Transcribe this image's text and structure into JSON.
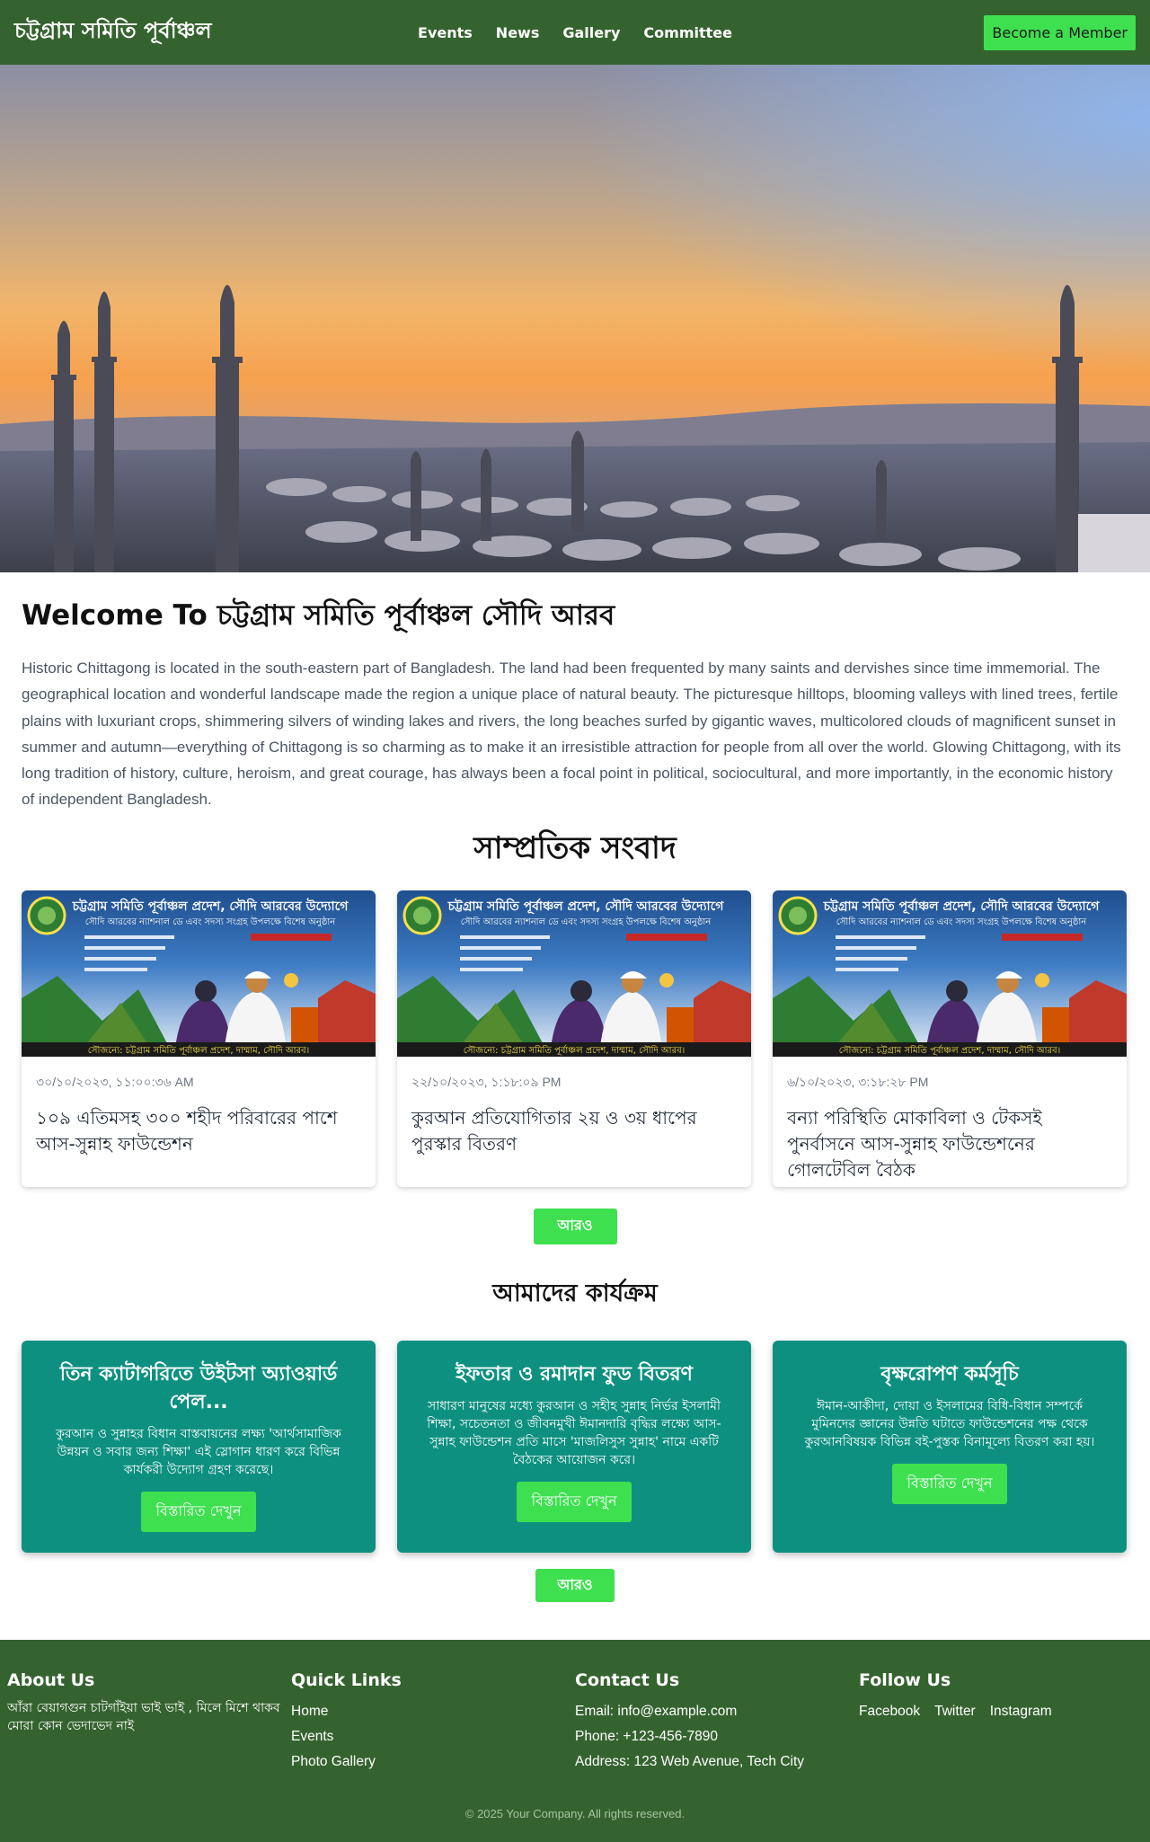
{
  "nav": {
    "brand": "চট্টগ্রাম সমিতি পূর্বাঞ্চল",
    "links": [
      "Events",
      "News",
      "Gallery",
      "Committee"
    ],
    "cta": "Become a Member"
  },
  "welcome": {
    "title": "Welcome To চট্টগ্রাম সমিতি পূর্বাঞ্চল সৌদি আরব",
    "body": "Historic Chittagong is located in the south-eastern part of Bangladesh. The land had been frequented by many saints and dervishes since time immemorial. The geographical location and wonderful landscape made the region a unique place of natural beauty. The picturesque hilltops, blooming valleys with lined trees, fertile plains with luxuriant crops, shimmering silvers of winding lakes and rivers, the long beaches surfed by gigantic waves, multicolored clouds of magnificent sunset in summer and autumn—everything of Chittagong is so charming as to make it an irresistible attraction for people from all over the world. Glowing Chittagong, with its long tradition of history, culture, heroism, and great courage, has always been a focal point in political, sociocultural, and more importantly, in the economic history of independent Bangladesh."
  },
  "news": {
    "title": "সাম্প্রতিক সংবাদ",
    "banner_title": "চট্টগ্রাম সমিতি পূর্বাঞ্চল প্রদেশ, সৌদি আরবের উদ্যোগে",
    "banner_sub": "সৌদি আরবের ন্যাশনাল ডে এবং সদস্য সংগ্রহ উপলক্ষে বিশেষ অনুষ্ঠান",
    "banner_footer": "সৌজন্যে: চট্টগ্রাম সমিতি পূর্বাঞ্চল প্রদেশ, দাম্মাম, সৌদি আরব।",
    "items": [
      {
        "date": "৩০/১০/২০২৩, ১১:০০:৩৬ AM",
        "headline": "১০৯ এতিমসহ ৩০০ শহীদ পরিবারের পাশে আস-সুন্নাহ ফাউন্ডেশন"
      },
      {
        "date": "২২/১০/২০২৩, ১:১৮:০৯ PM",
        "headline": "কুরআন প্রতিযোগিতার ২য় ও ৩য় ধাপের পুরস্কার বিতরণ"
      },
      {
        "date": "৬/১০/২০২৩, ৩:১৮:২৮ PM",
        "headline": "বন্যা পরিস্থিতি মোকাবিলা ও টেকসই পুনর্বাসনে আস-সুন্নাহ ফাউন্ডেশনের গোলটেবিল বৈঠক"
      }
    ],
    "more": "আরও"
  },
  "programs": {
    "title": "আমাদের কার্যক্রম",
    "items": [
      {
        "title": "তিন ক্যাটাগরিতে উইটসা অ্যাওয়ার্ড পেল...",
        "desc": "কুরআন ও সুন্নাহর বিধান বাস্তবায়নের লক্ষ্য 'আর্থসামাজিক উন্নয়ন ও সবার জন্য শিক্ষা' এই স্লোগান ধারণ করে বিভিন্ন কার্যকরী উদ্যোগ গ্রহণ করেছে।",
        "button": "বিস্তারিত দেখুন"
      },
      {
        "title": "ইফতার ও রমাদান ফুড বিতরণ",
        "desc": "সাধারণ মানুষের মধ্যে কুরআন ও সহীহ সুন্নাহ নির্ভর ইসলামী শিক্ষা, সচেতনতা ও জীবনমুখী ঈমানদারি বৃদ্ধির লক্ষ্যে আস-সুন্নাহ ফাউন্ডেশন প্রতি মাসে 'মাজলিসুস সুন্নাহ' নামে একটি বৈঠকের আয়োজন করে।",
        "button": "বিস্তারিত দেখুন"
      },
      {
        "title": "বৃক্ষরোপণ কর্মসূচি",
        "desc": "ঈমান-আকীদা, দোয়া ও ইসলামের বিধি-বিধান সম্পর্কে মুমিনদের জ্ঞানের উন্নতি ঘটাতে ফাউন্ডেশনের পক্ষ থেকে কুরআনবিষয়ক বিভিন্ন বই-পুস্তক বিনামূল্যে বিতরণ করা হয়।",
        "button": "বিস্তারিত দেখুন"
      }
    ],
    "more": "আরও"
  },
  "footer": {
    "about": {
      "title": "About Us",
      "text": "আঁরা বেয়াগগুন চাটগাঁইয়া ভাই ভাই , মিলে মিশে থাকব মোরা কোন ভেদাভেদ নাই"
    },
    "links": {
      "title": "Quick Links",
      "items": [
        "Home",
        "Events",
        "Photo Gallery"
      ]
    },
    "contact": {
      "title": "Contact Us",
      "email": "Email: info@example.com",
      "phone": "Phone: +123-456-7890",
      "address": "Address: 123 Web Avenue, Tech City"
    },
    "follow": {
      "title": "Follow Us",
      "items": [
        "Facebook",
        "Twitter",
        "Instagram"
      ]
    },
    "copyright": "© 2025 Your Company. All rights reserved."
  },
  "colors": {
    "header_bg": "#35632f",
    "accent_green": "#3ee04f",
    "card_teal": "#0d9080"
  }
}
